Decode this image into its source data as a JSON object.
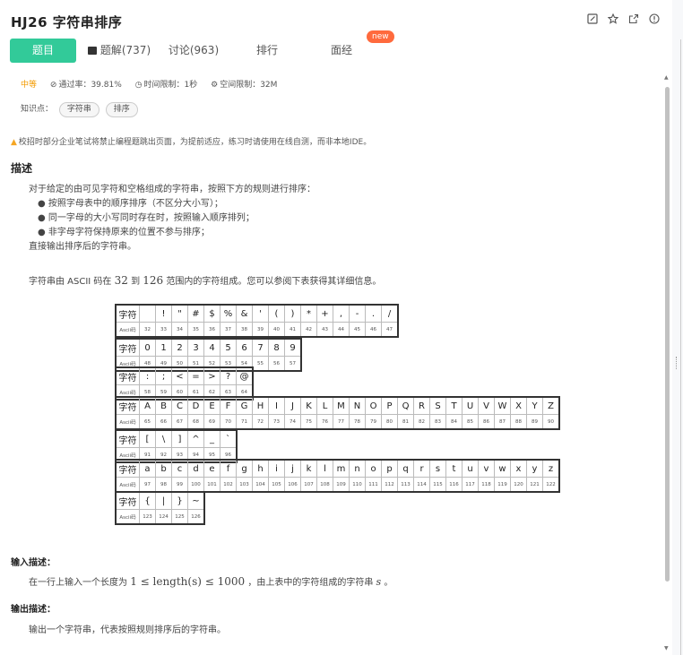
{
  "header": {
    "title": "HJ26  字符串排序"
  },
  "tabs": [
    {
      "label": "题目"
    },
    {
      "label": "题解(737)"
    },
    {
      "label": "讨论(963)"
    },
    {
      "label": "排行"
    },
    {
      "label": "面经"
    }
  ],
  "new_badge": "new",
  "meta": {
    "difficulty": "中等",
    "pass_rate": "通过率：39.81%",
    "time_limit": "时间限制：1秒",
    "space_limit": "空间限制：32M"
  },
  "tags": {
    "label": "知识点：",
    "items": [
      "字符串",
      "排序"
    ]
  },
  "warning": "校招时部分企业笔试将禁止编程题跳出页面，为提前适应，练习时请使用在线自测，而非本地IDE。",
  "description": {
    "heading": "描述",
    "intro": "对于给定的由可见字符和空格组成的字符串，按照下方的规则进行排序：",
    "bullets": [
      "按照字母表中的顺序排序（不区分大小写）；",
      "同一字母的大小写同时存在时，按照输入顺序排列；",
      "非字母字符保持原来的位置不参与排序；"
    ],
    "outro": "直接输出排序后的字符串。",
    "ascii_pre": "字符串由 ASCII 码在 ",
    "ascii_lo": "32",
    "ascii_mid": " 到 ",
    "ascii_hi": "126",
    "ascii_post": " 范围内的字符组成。您可以参阅下表获得其详细信息。"
  },
  "ascii_table": {
    "char_label": "字符",
    "code_label": "Ascii码",
    "rows": [
      {
        "chars": [
          " ",
          "!",
          "\"",
          "#",
          "$",
          "%",
          "&",
          "'",
          "(",
          ")",
          "*",
          "+",
          ",",
          "-",
          ".",
          "/"
        ],
        "codes": [
          "32",
          "33",
          "34",
          "35",
          "36",
          "37",
          "38",
          "39",
          "40",
          "41",
          "42",
          "43",
          "44",
          "45",
          "46",
          "47"
        ]
      },
      {
        "chars": [
          "0",
          "1",
          "2",
          "3",
          "4",
          "5",
          "6",
          "7",
          "8",
          "9"
        ],
        "codes": [
          "48",
          "49",
          "50",
          "51",
          "52",
          "53",
          "54",
          "55",
          "56",
          "57"
        ]
      },
      {
        "chars": [
          ":",
          ";",
          "<",
          "=",
          ">",
          "?",
          "@"
        ],
        "codes": [
          "58",
          "59",
          "60",
          "61",
          "62",
          "63",
          "64"
        ]
      },
      {
        "chars": [
          "A",
          "B",
          "C",
          "D",
          "E",
          "F",
          "G",
          "H",
          "I",
          "J",
          "K",
          "L",
          "M",
          "N",
          "O",
          "P",
          "Q",
          "R",
          "S",
          "T",
          "U",
          "V",
          "W",
          "X",
          "Y",
          "Z"
        ],
        "codes": [
          "65",
          "66",
          "67",
          "68",
          "69",
          "70",
          "71",
          "72",
          "73",
          "74",
          "75",
          "76",
          "77",
          "78",
          "79",
          "80",
          "81",
          "82",
          "83",
          "84",
          "85",
          "86",
          "87",
          "88",
          "89",
          "90"
        ]
      },
      {
        "chars": [
          "[",
          "\\",
          "]",
          "^",
          "_",
          "`"
        ],
        "codes": [
          "91",
          "92",
          "93",
          "94",
          "95",
          "96"
        ]
      },
      {
        "chars": [
          "a",
          "b",
          "c",
          "d",
          "e",
          "f",
          "g",
          "h",
          "i",
          "j",
          "k",
          "l",
          "m",
          "n",
          "o",
          "p",
          "q",
          "r",
          "s",
          "t",
          "u",
          "v",
          "w",
          "x",
          "y",
          "z"
        ],
        "codes": [
          "97",
          "98",
          "99",
          "100",
          "101",
          "102",
          "103",
          "104",
          "105",
          "106",
          "107",
          "108",
          "109",
          "110",
          "111",
          "112",
          "113",
          "114",
          "115",
          "116",
          "117",
          "118",
          "119",
          "120",
          "121",
          "122"
        ]
      },
      {
        "chars": [
          "{",
          "|",
          "}",
          "~"
        ],
        "codes": [
          "123",
          "124",
          "125",
          "126"
        ]
      }
    ]
  },
  "input_desc": {
    "heading": "输入描述：",
    "pre": "在一行上输入一个长度为 ",
    "math": "1 ≤ length(s) ≤ 1000",
    "post": " ，由上表中的字符组成的字符串 ",
    "var": "s",
    "end": " 。"
  },
  "output_desc": {
    "heading": "输出描述：",
    "text": "输出一个字符串，代表按照规则排序后的字符串。"
  },
  "icons": [
    "edit-icon",
    "star-icon",
    "share-icon",
    "info-icon",
    "video-icon",
    "clock-icon",
    "check-circle-icon",
    "memory-icon",
    "warning-icon"
  ]
}
